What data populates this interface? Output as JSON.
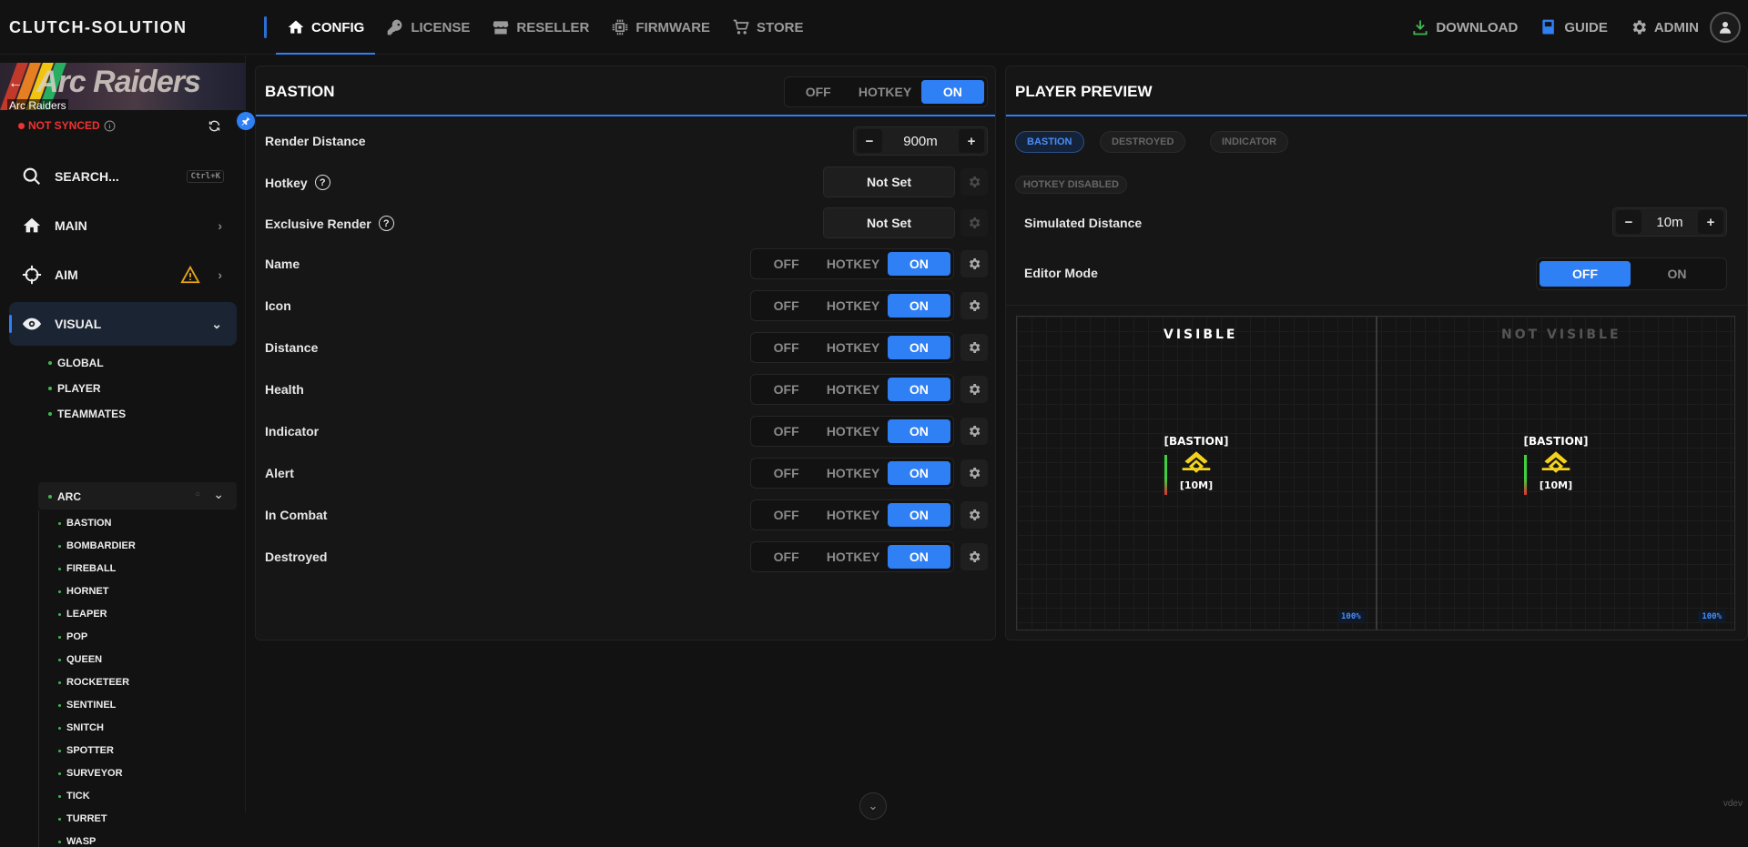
{
  "brand": "CLUTCH-SOLUTION",
  "nav": {
    "items": [
      {
        "label": "CONFIG",
        "icon": "home-icon"
      },
      {
        "label": "LICENSE",
        "icon": "key-icon"
      },
      {
        "label": "RESELLER",
        "icon": "store-front-icon"
      },
      {
        "label": "FIRMWARE",
        "icon": "chip-icon"
      },
      {
        "label": "STORE",
        "icon": "cart-icon"
      }
    ],
    "active": "CONFIG",
    "right": {
      "download": "DOWNLOAD",
      "guide": "GUIDE",
      "admin": "ADMIN"
    }
  },
  "sidebar": {
    "game": "Arc Raiders",
    "banner_text": "Arc Raiders",
    "sync_status": "NOT SYNCED",
    "search": {
      "label": "SEARCH...",
      "shortcut": "Ctrl+K"
    },
    "items": {
      "main": "MAIN",
      "aim": "AIM",
      "visual": "VISUAL"
    },
    "visual_sub": [
      "GLOBAL",
      "PLAYER",
      "TEAMMATES",
      "ARC"
    ],
    "arc_sub": [
      "BASTION",
      "BOMBARDIER",
      "FIREBALL",
      "HORNET",
      "LEAPER",
      "POP",
      "QUEEN",
      "ROCKETEER",
      "SENTINEL",
      "SNITCH",
      "SPOTTER",
      "SURVEYOR",
      "TICK",
      "TURRET",
      "WASP"
    ]
  },
  "bastion": {
    "title": "BASTION",
    "mode": {
      "off": "OFF",
      "hotkey": "HOTKEY",
      "on": "ON"
    },
    "render_distance": {
      "label": "Render Distance",
      "value": "900m"
    },
    "hotkey": {
      "label": "Hotkey",
      "value": "Not Set"
    },
    "exclusive_render": {
      "label": "Exclusive Render",
      "value": "Not Set"
    },
    "toggles": [
      "Name",
      "Icon",
      "Distance",
      "Health",
      "Indicator",
      "Alert",
      "In Combat",
      "Destroyed"
    ]
  },
  "preview": {
    "title": "PLAYER PREVIEW",
    "tabs": [
      "BASTION",
      "DESTROYED",
      "INDICATOR"
    ],
    "hotkey_badge": "HOTKEY DISABLED",
    "simulated_distance": {
      "label": "Simulated Distance",
      "value": "10m"
    },
    "editor_mode": {
      "label": "Editor Mode",
      "off": "OFF",
      "on": "ON"
    },
    "visible": "VISIBLE",
    "not_visible": "NOT VISIBLE",
    "esp_name": "[BASTION]",
    "esp_distance": "[10M]",
    "zoom": "100%"
  },
  "colors": {
    "accent": "#2f7ff5",
    "warning": "#e8a317",
    "error": "#e33333",
    "esp_icon": "#f4d21c"
  },
  "version": "vdev"
}
